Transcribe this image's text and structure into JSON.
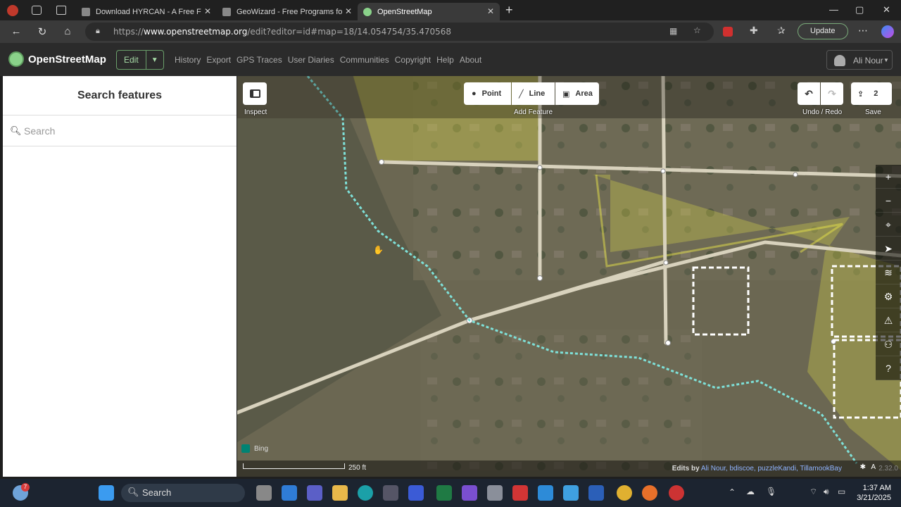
{
  "browser": {
    "tabs": [
      {
        "title": "Download HYRCAN - A Free FEM",
        "active": false
      },
      {
        "title": "GeoWizard - Free Programs for G",
        "active": false
      },
      {
        "title": "OpenStreetMap",
        "active": true
      }
    ],
    "new_tab": "+",
    "url_prefix": "https://",
    "url_host": "www.openstreetmap.org",
    "url_path": "/edit?editor=id#map=18/14.054754/35.470568",
    "update_label": "Update"
  },
  "osm": {
    "logo_text": "OpenStreetMap",
    "edit_label": "Edit",
    "nav": [
      "History",
      "Export",
      "GPS Traces",
      "User Diaries",
      "Communities",
      "Copyright",
      "Help",
      "About"
    ],
    "user": "Ali Nour"
  },
  "sidebar": {
    "title": "Search features",
    "search_placeholder": "Search"
  },
  "toolbar": {
    "inspect_label": "Inspect",
    "point_label": "Point",
    "line_label": "Line",
    "area_label": "Area",
    "add_feature_label": "Add Feature",
    "undo_redo_label": "Undo / Redo",
    "save_count": "2",
    "save_label": "Save"
  },
  "map_footer": {
    "scale_label": "250 ft",
    "edits_prefix": "Edits by",
    "edits_users": "Ali Nour, bdiscoe, puzzleKandi, TillamookBay",
    "version": "2.32.0",
    "imagery": "Bing"
  },
  "taskbar": {
    "search_label": "Search",
    "weather_badge": "7",
    "time": "1:37 AM",
    "date": "3/21/2025"
  },
  "colors": {
    "accent_green": "#7ebc6f",
    "trail": "#7ee0d8",
    "area_yellow": "#e6e24a"
  }
}
